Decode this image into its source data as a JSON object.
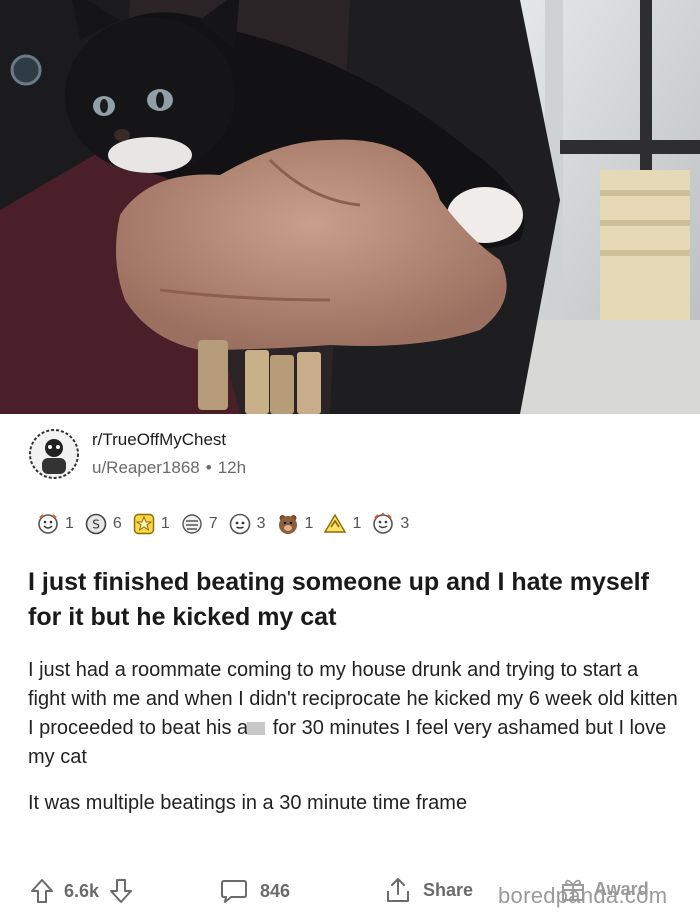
{
  "post": {
    "subreddit": "r/TrueOffMyChest",
    "username": "u/Reaper1868",
    "separator": "•",
    "age": "12h",
    "title": "I just finished beating someone up and I hate myself for it but he kicked my cat",
    "body_p1_before": "I just had a roommate coming to my house drunk and trying to start a fight with me and when I didn't reciprocate he kicked my 6 week old kitten I proceeded to beat his a",
    "body_p1_after": " for 30 minutes I feel very ashamed but I love my cat",
    "body_p2": "It was multiple beatings in a 30 minute time frame"
  },
  "awards": [
    {
      "icon": "wholesome-award-icon",
      "count": "1"
    },
    {
      "icon": "silver-coin-award-icon",
      "count": "6"
    },
    {
      "icon": "gold-star-award-icon",
      "count": "1"
    },
    {
      "icon": "hugz-award-icon",
      "count": "7"
    },
    {
      "icon": "helpful-award-icon",
      "count": "3"
    },
    {
      "icon": "bear-award-icon",
      "count": "1"
    },
    {
      "icon": "rocket-like-award-icon",
      "count": "1"
    },
    {
      "icon": "wholesome-seal-award-icon",
      "count": "3"
    }
  ],
  "actions": {
    "upvotes": "6.6k",
    "comments": "846",
    "share_label": "Share",
    "award_label": "Award"
  },
  "watermark": "boredpanda.com",
  "colors": {
    "text_primary": "#1a1a1b",
    "text_secondary": "#6b6b6b",
    "background": "#ffffff"
  }
}
